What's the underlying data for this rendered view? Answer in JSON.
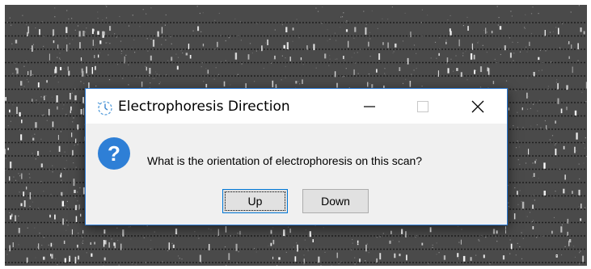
{
  "background": {
    "description_color": "#4a4a4a"
  },
  "dialog": {
    "title": "Electrophoresis Direction",
    "icon": "timer-icon",
    "accent": "#2b79d3",
    "minimize_label": "—",
    "maximize_label": "☐",
    "close_label": "✕",
    "question_icon": "question-icon",
    "message": "What is the orientation of electrophoresis on this scan?",
    "buttons": {
      "up": "Up",
      "down": "Down"
    }
  }
}
